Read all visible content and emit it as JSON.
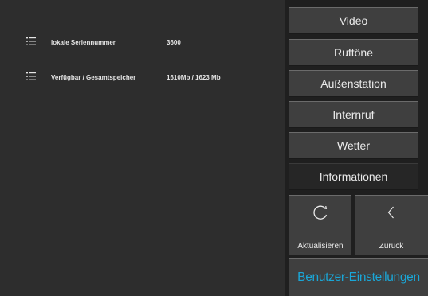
{
  "info": {
    "rows": [
      {
        "label": "lokale Seriennummer",
        "value": "3600"
      },
      {
        "label": "Verfügbar / Gesamtspeicher",
        "value": "1610Mb / 1623 Mb"
      }
    ]
  },
  "menu": {
    "video": "Video",
    "ringtones": "Ruftöne",
    "outdoor_station": "Außenstation",
    "intercom": "Internruf",
    "weather": "Wetter",
    "information": "Informationen"
  },
  "actions": {
    "refresh": "Aktualisieren",
    "back": "Zurück"
  },
  "footer": {
    "title": "Benutzer-Einstellungen"
  },
  "colors": {
    "accent": "#1aa7d8",
    "button_bg": "#3f3f3f",
    "active_bg": "#262626"
  }
}
